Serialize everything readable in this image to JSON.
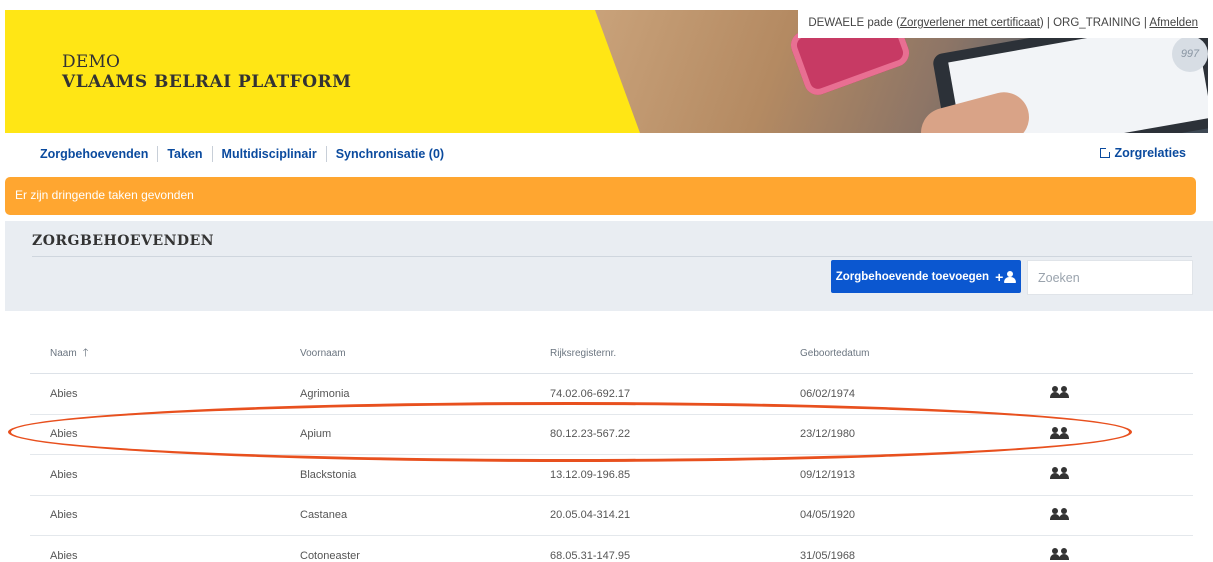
{
  "header": {
    "demo_label": "DEMO",
    "platform_title": "VLAAMS BELRAI PLATFORM",
    "gauge_value": "997",
    "user": {
      "name": "DEWAELE pade (",
      "role_link": "Zorgverlener met certificaat",
      "org": ") | ORG_TRAINING | ",
      "logout": "Afmelden"
    }
  },
  "nav": {
    "items": [
      {
        "label": "Zorgbehoevenden"
      },
      {
        "label": "Taken"
      },
      {
        "label": "Multidisciplinair"
      },
      {
        "label": "Synchronisatie (0)"
      }
    ],
    "right_label": "Zorgrelaties"
  },
  "alert": {
    "text": "Er zijn dringende taken gevonden",
    "color": "#ffa630"
  },
  "section": {
    "title": "ZORGBEHOEVENDEN",
    "add_button_label": "Zorgbehoevende toevoegen",
    "search_placeholder": "Zoeken"
  },
  "table": {
    "headers": [
      "Naam",
      "Voornaam",
      "Rijksregisternr.",
      "Geboortedatum"
    ],
    "sort_icon": "arrow-up-icon",
    "rows": [
      {
        "naam": "Abies",
        "voornaam": "Agrimonia",
        "rijksregisternr": "74.02.06-692.17",
        "geboortedatum": "06/02/1974"
      },
      {
        "naam": "Abies",
        "voornaam": "Apium",
        "rijksregisternr": "80.12.23-567.22",
        "geboortedatum": "23/12/1980"
      },
      {
        "naam": "Abies",
        "voornaam": "Blackstonia",
        "rijksregisternr": "13.12.09-196.85",
        "geboortedatum": "09/12/1913"
      },
      {
        "naam": "Abies",
        "voornaam": "Castanea",
        "rijksregisternr": "20.05.04-314.21",
        "geboortedatum": "04/05/1920"
      },
      {
        "naam": "Abies",
        "voornaam": "Cotoneaster",
        "rijksregisternr": "68.05.31-147.95",
        "geboortedatum": "31/05/1968"
      }
    ],
    "row_icon": "people-icon"
  },
  "colors": {
    "brand_yellow": "#ffe615",
    "link_blue": "#0a4a9e",
    "button_blue": "#0b57d0",
    "annotation_red": "#e8501e"
  }
}
